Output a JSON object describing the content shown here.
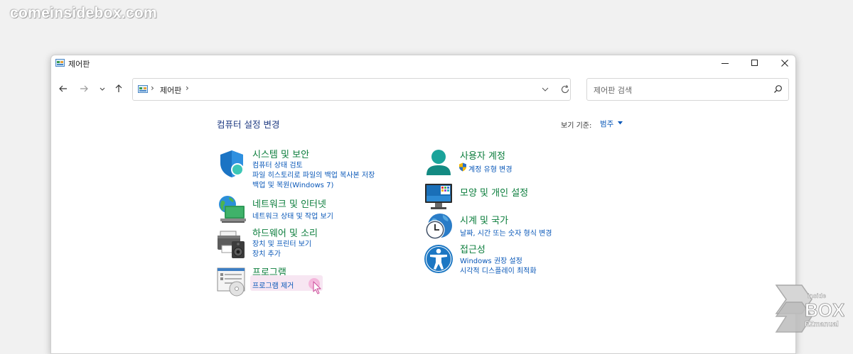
{
  "watermark": "comeinsidebox.com",
  "window": {
    "title": "제어판",
    "buttons": [
      "minimize",
      "maximize",
      "close"
    ]
  },
  "nav": {
    "back_icon": "arrow-left-icon",
    "forward_icon": "arrow-right-icon",
    "recent_icon": "chevron-down-icon",
    "up_icon": "arrow-up-icon"
  },
  "address": {
    "path": "제어판",
    "separator": "›"
  },
  "search": {
    "placeholder": "제어판 검색"
  },
  "heading": "컴퓨터 설정 변경",
  "view_by": {
    "label": "보기 기준:",
    "value": "범주"
  },
  "categories": [
    {
      "title": "시스템 및 보안",
      "icon": "shield-icon",
      "links": [
        "컴퓨터 상태 검토",
        "파일 히스토리로 파일의 백업 복사본 저장",
        "백업 및 복원(Windows 7)"
      ]
    },
    {
      "title": "네트워크 및 인터넷",
      "icon": "network-globe-icon",
      "links": [
        "네트워크 상태 및 작업 보기"
      ]
    },
    {
      "title": "하드웨어 및 소리",
      "icon": "printer-speaker-icon",
      "links": [
        "장치 및 프린터 보기",
        "장치 추가"
      ]
    },
    {
      "title": "프로그램",
      "icon": "programs-icon",
      "links": [
        "프로그램 제거"
      ]
    },
    {
      "title": "사용자 계정",
      "icon": "user-accounts-icon",
      "links": [
        "계정 유형 변경"
      ]
    },
    {
      "title": "모양 및 개인 설정",
      "icon": "monitor-icon",
      "links": []
    },
    {
      "title": "시계 및 국가",
      "icon": "clock-globe-icon",
      "links": [
        "날짜, 시간 또는 숫자 형식 변경"
      ]
    },
    {
      "title": "접근성",
      "icon": "accessibility-icon",
      "links": [
        "Windows 권장 설정",
        "시각적 디스플레이 최적화"
      ]
    }
  ],
  "logo": {
    "text": "inside BOX EZmanual"
  },
  "colors": {
    "link": "#0a58b8",
    "category_title": "#0b7d3c",
    "heading": "#1e3a82",
    "highlight": "#f7e6f2"
  }
}
